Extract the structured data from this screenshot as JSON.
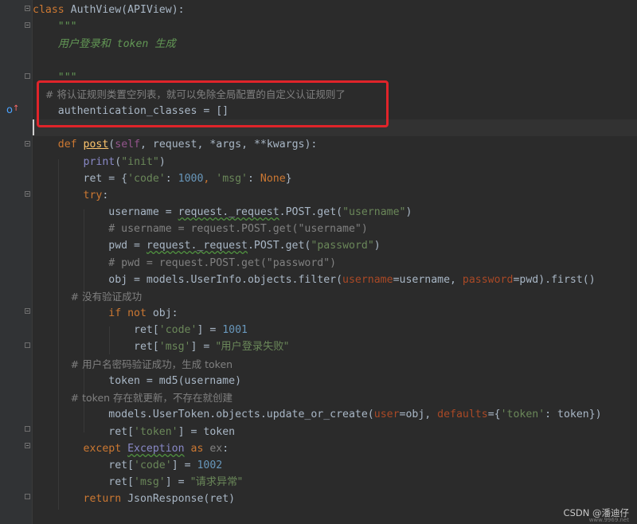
{
  "editor": {
    "colors": {
      "background": "#2b2b2b",
      "annotation_box": "#e0242a",
      "keyword": "#cc7832",
      "string": "#6a8759",
      "comment": "#808080"
    },
    "gutter_icons": {
      "override": "override-method-icon"
    },
    "lines": [
      {
        "tokens": [
          {
            "t": "class ",
            "c": "kw"
          },
          {
            "t": "AuthView(",
            "c": "plain"
          },
          {
            "t": "APIView",
            "c": "plain"
          },
          {
            "t": "):",
            "c": "plain"
          }
        ]
      },
      {
        "tokens": [
          {
            "t": "    \"\"\"",
            "c": "doc"
          }
        ]
      },
      {
        "tokens": [
          {
            "t": "    用户登录和 token 生成",
            "c": "doc"
          }
        ]
      },
      {
        "tokens": []
      },
      {
        "tokens": [
          {
            "t": "    \"\"\"",
            "c": "doc"
          }
        ]
      },
      {
        "tokens": [
          {
            "t": "    # 将认证规则类置空列表，就可以免除全局配置的自定义认证规则了",
            "c": "cm-cn"
          }
        ]
      },
      {
        "tokens": [
          {
            "t": "    authentication_classes = []",
            "c": "plain"
          }
        ]
      },
      {
        "tokens": []
      },
      {
        "tokens": [
          {
            "t": "    ",
            "c": "plain"
          },
          {
            "t": "def ",
            "c": "kw"
          },
          {
            "t": "post",
            "c": "fn under"
          },
          {
            "t": "(",
            "c": "plain"
          },
          {
            "t": "self",
            "c": "selfp"
          },
          {
            "t": ", request, *",
            "c": "plain"
          },
          {
            "t": "args",
            "c": "plain"
          },
          {
            "t": ", **",
            "c": "plain"
          },
          {
            "t": "kwargs",
            "c": "plain"
          },
          {
            "t": "):",
            "c": "plain"
          }
        ]
      },
      {
        "tokens": [
          {
            "t": "        ",
            "c": "plain"
          },
          {
            "t": "print",
            "c": "bi"
          },
          {
            "t": "(",
            "c": "plain"
          },
          {
            "t": "\"init\"",
            "c": "str"
          },
          {
            "t": ")",
            "c": "plain"
          }
        ]
      },
      {
        "tokens": [
          {
            "t": "        ret = {",
            "c": "plain"
          },
          {
            "t": "'code'",
            "c": "str"
          },
          {
            "t": ": ",
            "c": "plain"
          },
          {
            "t": "1000",
            "c": "num"
          },
          {
            "t": ", ",
            "c": "kw"
          },
          {
            "t": "'msg'",
            "c": "str"
          },
          {
            "t": ": ",
            "c": "plain"
          },
          {
            "t": "None",
            "c": "kw"
          },
          {
            "t": "}",
            "c": "plain"
          }
        ]
      },
      {
        "tokens": [
          {
            "t": "        ",
            "c": "plain"
          },
          {
            "t": "try",
            "c": "kw"
          },
          {
            "t": ":",
            "c": "plain"
          }
        ]
      },
      {
        "tokens": [
          {
            "t": "            username = ",
            "c": "plain"
          },
          {
            "t": "request._request",
            "c": "plain squig"
          },
          {
            "t": ".POST.get(",
            "c": "plain"
          },
          {
            "t": "\"username\"",
            "c": "str"
          },
          {
            "t": ")",
            "c": "plain"
          }
        ]
      },
      {
        "tokens": [
          {
            "t": "            # username = request.POST.get(\"username\")",
            "c": "cm"
          }
        ]
      },
      {
        "tokens": [
          {
            "t": "            pwd = ",
            "c": "plain"
          },
          {
            "t": "request._request",
            "c": "plain squig"
          },
          {
            "t": ".POST.get(",
            "c": "plain"
          },
          {
            "t": "\"password\"",
            "c": "str"
          },
          {
            "t": ")",
            "c": "plain"
          }
        ]
      },
      {
        "tokens": [
          {
            "t": "            # pwd = request.POST.get(\"password\")",
            "c": "cm"
          }
        ]
      },
      {
        "tokens": [
          {
            "t": "            obj = models.UserInfo.objects.filter(",
            "c": "plain"
          },
          {
            "t": "username",
            "c": "param"
          },
          {
            "t": "=username, ",
            "c": "plain"
          },
          {
            "t": "password",
            "c": "param"
          },
          {
            "t": "=pwd).first()",
            "c": "plain"
          }
        ]
      },
      {
        "tokens": [
          {
            "t": "            # 没有验证成功",
            "c": "cm-cn"
          }
        ]
      },
      {
        "tokens": [
          {
            "t": "            ",
            "c": "plain"
          },
          {
            "t": "if not ",
            "c": "kw"
          },
          {
            "t": "obj:",
            "c": "plain"
          }
        ]
      },
      {
        "tokens": [
          {
            "t": "                ret[",
            "c": "plain"
          },
          {
            "t": "'code'",
            "c": "str"
          },
          {
            "t": "] = ",
            "c": "plain"
          },
          {
            "t": "1001",
            "c": "num"
          }
        ]
      },
      {
        "tokens": [
          {
            "t": "                ret[",
            "c": "plain"
          },
          {
            "t": "'msg'",
            "c": "str"
          },
          {
            "t": "] = ",
            "c": "plain"
          },
          {
            "t": "\"用户登录失败\"",
            "c": "str str-cn"
          }
        ]
      },
      {
        "tokens": [
          {
            "t": "            # 用户名密码验证成功，生成 token",
            "c": "cm-cn"
          }
        ]
      },
      {
        "tokens": [
          {
            "t": "            token = md5(username)",
            "c": "plain"
          }
        ]
      },
      {
        "tokens": [
          {
            "t": "            # token 存在就更新，不存在就创建",
            "c": "cm-cn"
          }
        ]
      },
      {
        "tokens": [
          {
            "t": "            models.UserToken.objects.update_or_create(",
            "c": "plain"
          },
          {
            "t": "user",
            "c": "param"
          },
          {
            "t": "=obj, ",
            "c": "plain"
          },
          {
            "t": "defaults",
            "c": "param"
          },
          {
            "t": "={",
            "c": "plain"
          },
          {
            "t": "'token'",
            "c": "str"
          },
          {
            "t": ": token})",
            "c": "plain"
          }
        ]
      },
      {
        "tokens": [
          {
            "t": "            ret[",
            "c": "plain"
          },
          {
            "t": "'token'",
            "c": "str"
          },
          {
            "t": "] = token",
            "c": "plain"
          }
        ]
      },
      {
        "tokens": [
          {
            "t": "        ",
            "c": "plain"
          },
          {
            "t": "except ",
            "c": "kw"
          },
          {
            "t": "Exception",
            "c": "bi squig"
          },
          {
            "t": " as ",
            "c": "kw"
          },
          {
            "t": "ex",
            "c": "cm"
          },
          {
            "t": ":",
            "c": "plain"
          }
        ]
      },
      {
        "tokens": [
          {
            "t": "            ret[",
            "c": "plain"
          },
          {
            "t": "'code'",
            "c": "str"
          },
          {
            "t": "] = ",
            "c": "plain"
          },
          {
            "t": "1002",
            "c": "num"
          }
        ]
      },
      {
        "tokens": [
          {
            "t": "            ret[",
            "c": "plain"
          },
          {
            "t": "'msg'",
            "c": "str"
          },
          {
            "t": "] = ",
            "c": "plain"
          },
          {
            "t": "\"请求异常\"",
            "c": "str str-cn"
          }
        ]
      },
      {
        "tokens": [
          {
            "t": "        ",
            "c": "plain"
          },
          {
            "t": "return ",
            "c": "kw"
          },
          {
            "t": "JsonResponse(ret)",
            "c": "plain"
          }
        ]
      }
    ]
  },
  "watermark": {
    "text": "CSDN @潘迪仔",
    "subtext": "www.9969.net"
  }
}
